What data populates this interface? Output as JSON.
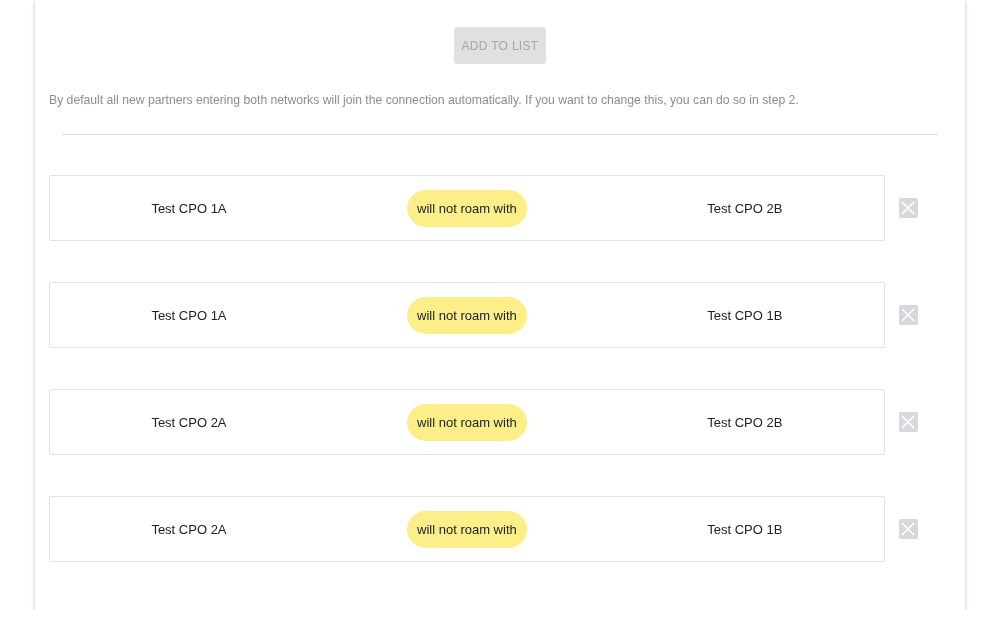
{
  "add_button": {
    "label": "ADD TO LIST",
    "disabled": true
  },
  "info_text": "By default all new partners entering both networks will join the connection automatically. If you want to change this, you can do so in step 2.",
  "rules": [
    {
      "left": "Test CPO 1A",
      "relation": "will not roam with",
      "right": "Test CPO 2B"
    },
    {
      "left": "Test CPO 1A",
      "relation": "will not roam with",
      "right": "Test CPO 1B"
    },
    {
      "left": "Test CPO 2A",
      "relation": "will not roam with",
      "right": "Test CPO 2B"
    },
    {
      "left": "Test CPO 2A",
      "relation": "will not roam with",
      "right": "Test CPO 1B"
    }
  ]
}
